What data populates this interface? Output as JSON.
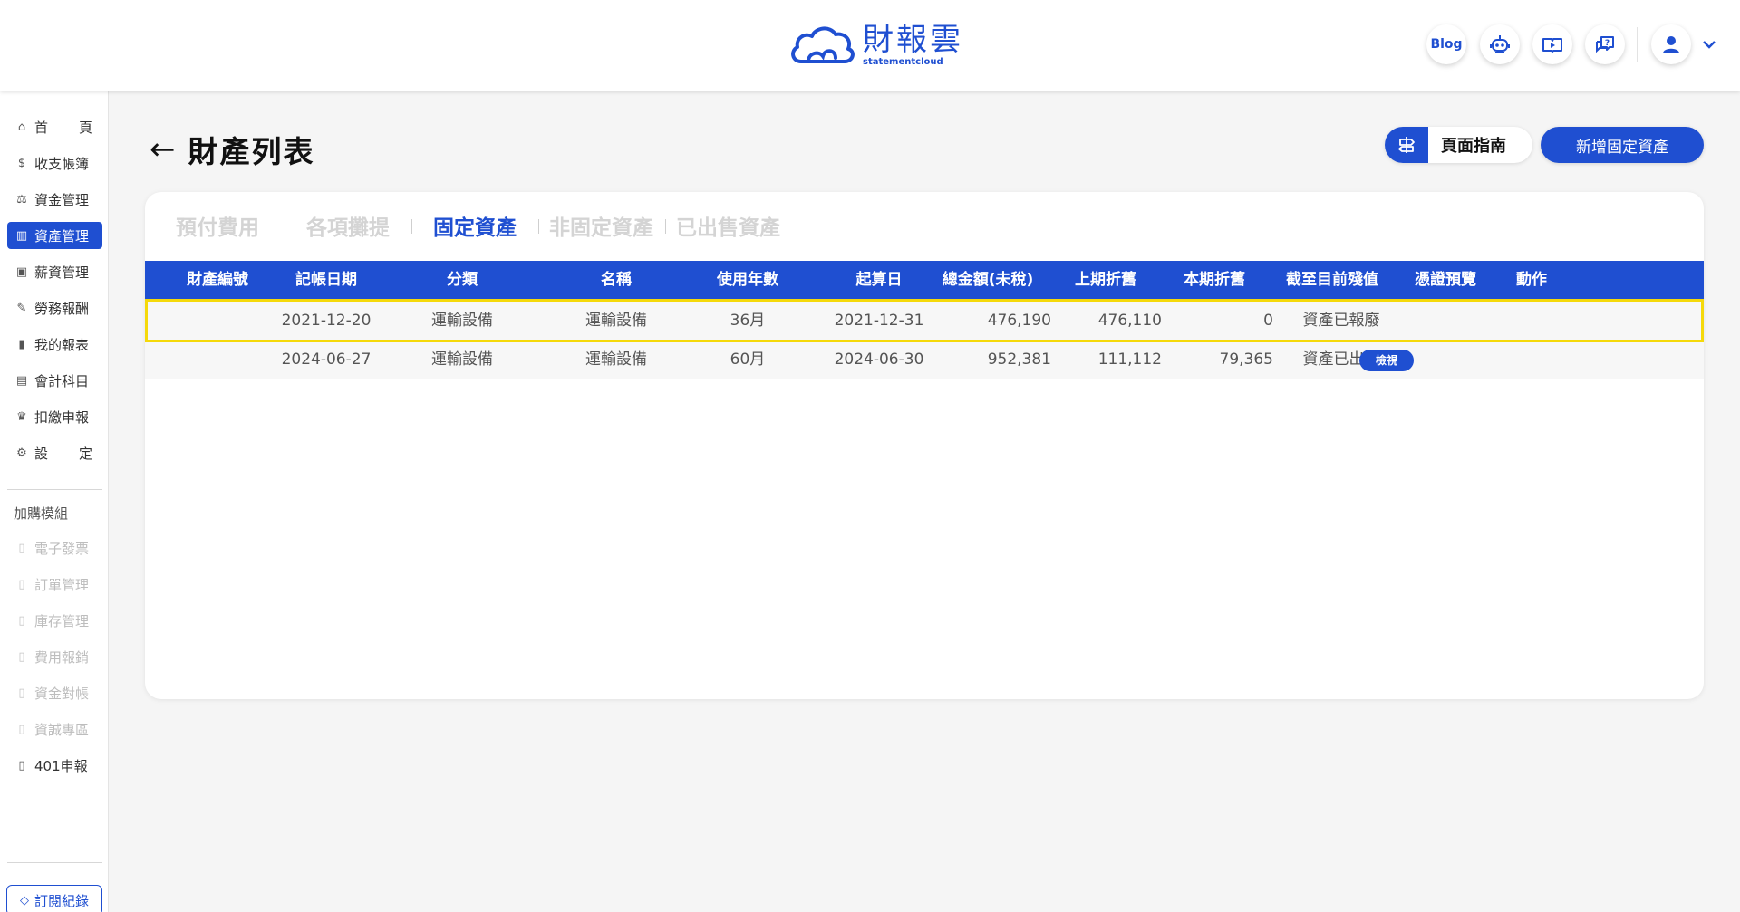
{
  "header": {
    "logo_cn": "財報雲",
    "logo_en": "statementcloud",
    "blog_label": "Blog",
    "icons": [
      "robot-icon",
      "video-guide-icon",
      "help-chat-icon",
      "user-avatar-icon",
      "chevron-down-icon"
    ]
  },
  "sidebar": {
    "items": [
      {
        "label": "首頁",
        "icon": "home-icon"
      },
      {
        "label": "收支帳簿",
        "icon": "ledger-icon"
      },
      {
        "label": "資金管理",
        "icon": "fund-icon"
      },
      {
        "label": "資產管理",
        "icon": "asset-chart-icon",
        "active": true
      },
      {
        "label": "薪資管理",
        "icon": "payroll-icon"
      },
      {
        "label": "勞務報酬",
        "icon": "labor-icon"
      },
      {
        "label": "我的報表",
        "icon": "report-icon"
      },
      {
        "label": "會計科目",
        "icon": "account-icon"
      },
      {
        "label": "扣繳申報",
        "icon": "withholding-icon"
      },
      {
        "label": "設定",
        "icon": "settings-icon"
      }
    ],
    "addon_label": "加購模組",
    "addons": [
      {
        "label": "電子發票",
        "icon": "lock-book-icon"
      },
      {
        "label": "訂單管理",
        "icon": "lock-book-icon"
      },
      {
        "label": "庫存管理",
        "icon": "lock-book-icon"
      },
      {
        "label": "費用報銷",
        "icon": "lock-book-icon"
      },
      {
        "label": "資金對帳",
        "icon": "lock-book-icon"
      },
      {
        "label": "資誠專區",
        "icon": "lock-book-icon"
      },
      {
        "label": "401申報",
        "icon": "book-icon"
      }
    ],
    "subscription_label": "訂閱紀錄"
  },
  "page": {
    "title": "財產列表",
    "guide_label": "頁面指南",
    "add_label": "新增固定資產"
  },
  "tabs": [
    {
      "label": "預付費用"
    },
    {
      "label": "各項攤提"
    },
    {
      "label": "固定資產",
      "active": true
    },
    {
      "label": "非固定資產"
    },
    {
      "label": "已出售資產"
    }
  ],
  "table": {
    "columns": [
      "財產編號",
      "記帳日期",
      "分類",
      "名稱",
      "使用年數",
      "起算日",
      "總金額(未稅)",
      "上期折舊",
      "本期折舊",
      "截至目前殘值",
      "憑證預覽",
      "動作"
    ],
    "rows": [
      {
        "asset_no": "",
        "date": "2021-12-20",
        "category": "運輸設備",
        "name": "運輸設備",
        "years": "36月",
        "start": "2021-12-31",
        "total": "476,190",
        "prev_dep": "476,110",
        "curr_dep": "0",
        "residual": "資產已報廢",
        "voucher": "",
        "action": ""
      },
      {
        "asset_no": "",
        "date": "2024-06-27",
        "category": "運輸設備",
        "name": "運輸設備",
        "years": "60月",
        "start": "2024-06-30",
        "total": "952,381",
        "prev_dep": "111,112",
        "curr_dep": "79,365",
        "residual": "資產已出售",
        "voucher": "",
        "action": "檢視"
      }
    ]
  },
  "colors": {
    "brand": "#1f4fd1",
    "highlight": "#f5d90a"
  }
}
